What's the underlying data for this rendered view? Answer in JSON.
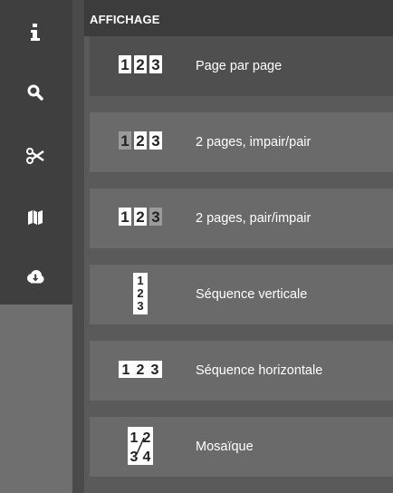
{
  "toolbar": {
    "items": [
      {
        "icon": "info-icon"
      },
      {
        "icon": "search-icon"
      },
      {
        "icon": "scissors-icon"
      },
      {
        "icon": "map-icon"
      },
      {
        "icon": "cloud-download-icon"
      }
    ]
  },
  "panel": {
    "title": "AFFICHAGE",
    "options": [
      {
        "label": "Page par page",
        "icon": "numbers-123-icon",
        "selected": true
      },
      {
        "label": "2 pages, impair/pair",
        "icon": "numbers-1-23-icon",
        "selected": false
      },
      {
        "label": "2 pages, pair/impair",
        "icon": "numbers-12-3-icon",
        "selected": false
      },
      {
        "label": "Séquence verticale",
        "icon": "vertical-sequence-icon",
        "selected": false
      },
      {
        "label": "Séquence horizontale",
        "icon": "horizontal-sequence-icon",
        "selected": false
      },
      {
        "label": "Mosaïque",
        "icon": "mosaic-icon",
        "selected": false
      }
    ],
    "icon_digits": [
      "1",
      "2",
      "3",
      "4"
    ]
  },
  "colors": {
    "selected_bg": "#4f4f4f",
    "item_bg": "#6a6a6a",
    "header_bg": "#3c3c3c",
    "toolbar_bg": "#3f3f3f",
    "text": "#ffffff"
  }
}
